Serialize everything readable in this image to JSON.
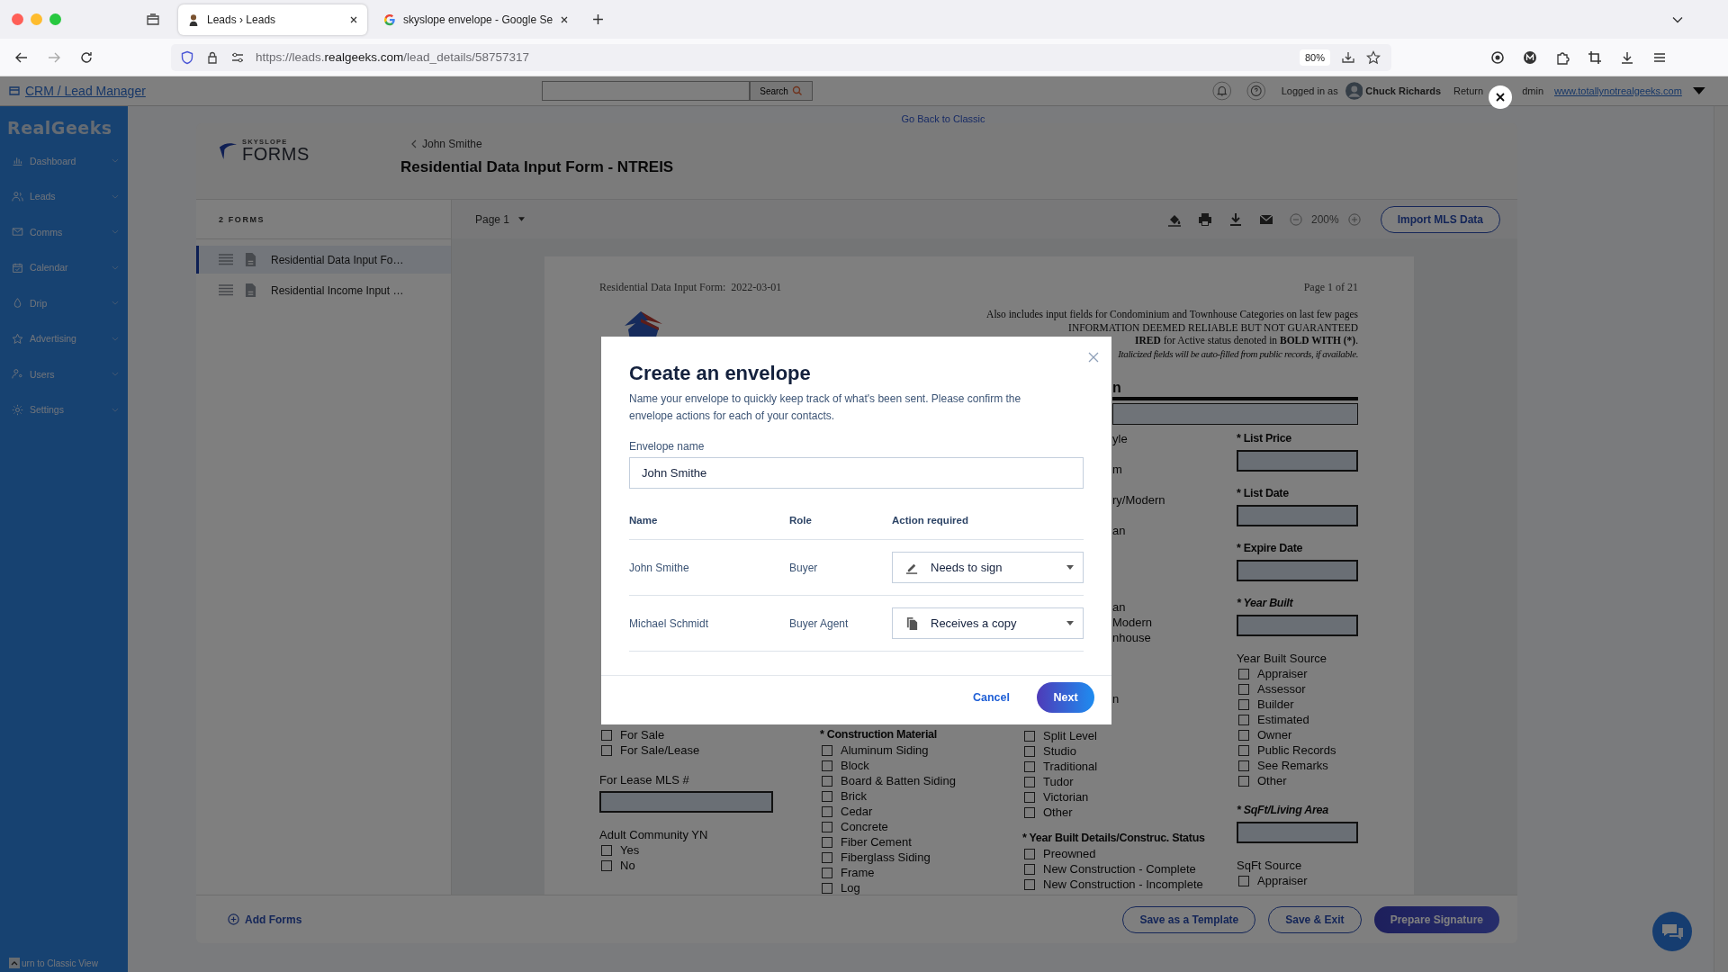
{
  "browser": {
    "tabs": [
      {
        "title": "Leads › Leads",
        "selected": true
      },
      {
        "title": "skyslope envelope - Google Se",
        "selected": false
      }
    ],
    "url": {
      "host_prefix": "https://leads.",
      "domain": "realgeeks.com",
      "path": "/lead_details/58757317"
    },
    "zoom": "80%"
  },
  "crm": {
    "title": "CRM / Lead Manager",
    "search_button": "Search",
    "logged_in_label": "Logged in as",
    "user": "Chuck Richards",
    "return_text": "Return",
    "return_tail": "dmin",
    "site_link": "www.totallynotrealgeeks.com",
    "go_back_link": "Go Back to Classic"
  },
  "sidebar": {
    "logo": "RealGeeks",
    "items": [
      {
        "label": "Dashboard"
      },
      {
        "label": "Leads"
      },
      {
        "label": "Comms"
      },
      {
        "label": "Calendar"
      },
      {
        "label": "Drip"
      },
      {
        "label": "Advertising"
      },
      {
        "label": "Users"
      },
      {
        "label": "Settings"
      }
    ],
    "footer_link": "urn to Classic View"
  },
  "forms_app": {
    "logo_small": "SKYSLOPE",
    "logo_large": "FORMS",
    "breadcrumb": "John Smithe",
    "title": "Residential Data Input Form - NTREIS",
    "forms_count": "2 FORMS",
    "forms": [
      {
        "title": "Residential Data Input Fo…",
        "selected": true
      },
      {
        "title": "Residential Income Input …",
        "selected": false
      }
    ],
    "page_select": "Page 1",
    "zoom": "200%",
    "import_button": "Import MLS Data",
    "add_forms": "Add Forms",
    "buttons": [
      {
        "label": "Save as a Template",
        "kind": "outline"
      },
      {
        "label": "Save & Exit",
        "kind": "outline"
      },
      {
        "label": "Prepare Signature",
        "kind": "primary"
      }
    ]
  },
  "document": {
    "date_line": "Residential Data Input Form:  2022-03-01",
    "page_label": "Page 1 of 21",
    "notes": [
      {
        "text": "Also includes input fields for Condominium and Townhouse Categories on last few pages",
        "italic": false
      },
      {
        "text": "INFORMATION DEEMED RELIABLE BUT NOT GUARANTEED",
        "italic": false
      },
      {
        "text": "**IRED** for Active status denoted in **BOLD WITH (*)**.",
        "italic": false
      },
      {
        "text": "Italicized fields will be auto-filled from public records, if available.",
        "italic": true
      }
    ],
    "section_fragment": "n",
    "fragments": [
      "yle",
      "m",
      "ry/Modern",
      "an",
      "an",
      "Modern",
      "nhouse",
      "n"
    ],
    "columns": [
      {
        "items": [
          {
            "kind": "checkbox",
            "label": "For Sale",
            "checked": false
          },
          {
            "kind": "checkbox",
            "label": "For Sale/Lease",
            "checked": false
          },
          {
            "kind": "field",
            "label": "For Lease MLS #",
            "bold": false,
            "italic": false
          },
          {
            "kind": "heading",
            "label": "Adult Community YN",
            "bold": false,
            "italic": false
          },
          {
            "kind": "checkbox",
            "label": "Yes",
            "checked": false
          },
          {
            "kind": "checkbox",
            "label": "No",
            "checked": false
          }
        ]
      },
      {
        "items": [
          {
            "kind": "heading",
            "label": "* Construction Material",
            "bold": true,
            "italic": false
          },
          {
            "kind": "checkbox",
            "label": "Aluminum Siding",
            "checked": false
          },
          {
            "kind": "checkbox",
            "label": "Block",
            "checked": false
          },
          {
            "kind": "checkbox",
            "label": "Board & Batten Siding",
            "checked": false
          },
          {
            "kind": "checkbox",
            "label": "Brick",
            "checked": false
          },
          {
            "kind": "checkbox",
            "label": "Cedar",
            "checked": false
          },
          {
            "kind": "checkbox",
            "label": "Concrete",
            "checked": false
          },
          {
            "kind": "checkbox",
            "label": "Fiber Cement",
            "checked": false
          },
          {
            "kind": "checkbox",
            "label": "Fiberglass Siding",
            "checked": false
          },
          {
            "kind": "checkbox",
            "label": "Frame",
            "checked": false
          },
          {
            "kind": "checkbox",
            "label": "Log",
            "checked": false
          }
        ]
      },
      {
        "items": [
          {
            "kind": "checkbox",
            "label": "Split Level",
            "checked": false
          },
          {
            "kind": "checkbox",
            "label": "Studio",
            "checked": false
          },
          {
            "kind": "checkbox",
            "label": "Traditional",
            "checked": false
          },
          {
            "kind": "checkbox",
            "label": "Tudor",
            "checked": false
          },
          {
            "kind": "checkbox",
            "label": "Victorian",
            "checked": false
          },
          {
            "kind": "checkbox",
            "label": "Other",
            "checked": false
          },
          {
            "kind": "heading",
            "label": "* Year Built Details/Construc. Status",
            "bold": true,
            "italic": false
          },
          {
            "kind": "checkbox",
            "label": "Preowned",
            "checked": false
          },
          {
            "kind": "checkbox",
            "label": "New Construction - Complete",
            "checked": false
          },
          {
            "kind": "checkbox",
            "label": "New Construction - Incomplete",
            "checked": false
          }
        ]
      },
      {
        "items": [
          {
            "kind": "field",
            "label": "* List Price",
            "bold": true,
            "italic": false
          },
          {
            "kind": "field",
            "label": "* List Date",
            "bold": true,
            "italic": false
          },
          {
            "kind": "field",
            "label": "* Expire Date",
            "bold": true,
            "italic": false
          },
          {
            "kind": "field",
            "label": "* Year Built",
            "bold": true,
            "italic": true
          },
          {
            "kind": "heading",
            "label": "Year Built Source",
            "bold": false,
            "italic": false
          },
          {
            "kind": "checkbox",
            "label": "Appraiser",
            "checked": false
          },
          {
            "kind": "checkbox",
            "label": "Assessor",
            "checked": false
          },
          {
            "kind": "checkbox",
            "label": "Builder",
            "checked": false
          },
          {
            "kind": "checkbox",
            "label": "Estimated",
            "checked": false
          },
          {
            "kind": "checkbox",
            "label": "Owner",
            "checked": false
          },
          {
            "kind": "checkbox",
            "label": "Public Records",
            "checked": false
          },
          {
            "kind": "checkbox",
            "label": "See Remarks",
            "checked": false
          },
          {
            "kind": "checkbox",
            "label": "Other",
            "checked": false
          },
          {
            "kind": "field",
            "label": "* SqFt/Living Area",
            "bold": true,
            "italic": true
          },
          {
            "kind": "heading",
            "label": "SqFt Source",
            "bold": false,
            "italic": false
          },
          {
            "kind": "checkbox",
            "label": "Appraiser",
            "checked": false
          }
        ]
      }
    ]
  },
  "modal": {
    "title": "Create an envelope",
    "description": "Name your envelope to quickly keep track of what's been sent. Please confirm the envelope actions for each of your contacts.",
    "name_label": "Envelope name",
    "name_value": "John Smithe",
    "columns": [
      "Name",
      "Role",
      "Action required"
    ],
    "contacts": [
      {
        "name": "John Smithe",
        "role": "Buyer",
        "action": "Needs to sign",
        "kind": "sign"
      },
      {
        "name": "Michael Schmidt",
        "role": "Buyer Agent",
        "action": "Receives a copy",
        "kind": "copy"
      }
    ],
    "cancel": "Cancel",
    "next": "Next"
  }
}
